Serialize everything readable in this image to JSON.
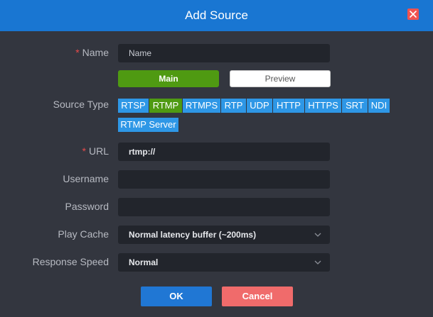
{
  "dialog": {
    "title": "Add Source"
  },
  "form": {
    "name": {
      "label": "Name",
      "required": true,
      "placeholder": "Name"
    },
    "stream_toggle": {
      "options": [
        "Main",
        "Preview"
      ],
      "selected": "Main"
    },
    "source_type": {
      "label": "Source Type",
      "options": [
        "RTSP",
        "RTMP",
        "RTMPS",
        "RTP",
        "UDP",
        "HTTP",
        "HTTPS",
        "SRT",
        "NDI",
        "RTMP Server"
      ],
      "selected": "RTMP"
    },
    "url": {
      "label": "URL",
      "required": true,
      "value": "rtmp://"
    },
    "username": {
      "label": "Username",
      "value": ""
    },
    "password": {
      "label": "Password",
      "value": ""
    },
    "play_cache": {
      "label": "Play Cache",
      "value": "Normal latency buffer (~200ms)"
    },
    "response_speed": {
      "label": "Response Speed",
      "value": "Normal"
    }
  },
  "actions": {
    "ok": "OK",
    "cancel": "Cancel"
  },
  "colors": {
    "header": "#1976d2",
    "body": "#33363f",
    "field": "#22252c",
    "active": "#4f9a12",
    "chip": "#2e97e6",
    "ok": "#2077d4",
    "cancel": "#f06b6b",
    "close": "#ef5350"
  },
  "icons": {
    "close": "close-icon",
    "dropdown": "chevron-down-icon"
  }
}
